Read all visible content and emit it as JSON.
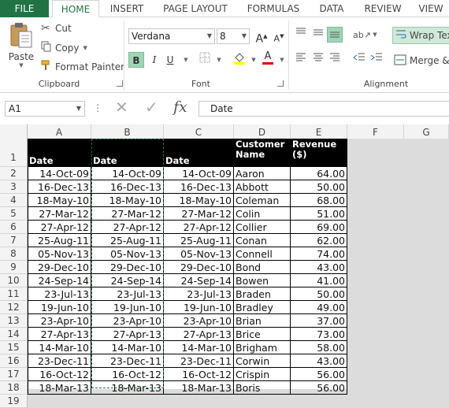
{
  "tabs": [
    "FILE",
    "HOME",
    "INSERT",
    "PAGE LAYOUT",
    "FORMULAS",
    "DATA",
    "REVIEW",
    "VIEW"
  ],
  "clipboard": {
    "paste": "Paste",
    "cut": "Cut",
    "copy": "Copy",
    "format_painter": "Format Painter",
    "label": "Clipboard"
  },
  "font": {
    "name": "Verdana",
    "size": "8",
    "label": "Font",
    "bold": "B",
    "italic": "I",
    "underline": "U",
    "grow": "A",
    "shrink": "A",
    "fill_color": "#ffff00",
    "font_color": "#e00000"
  },
  "alignment": {
    "wrap_text": "Wrap Tex",
    "merge": "Merge &",
    "label": "Alignment"
  },
  "formula_bar": {
    "name_box": "A1",
    "fx": "fx",
    "content": "Date"
  },
  "columns": [
    "A",
    "B",
    "C",
    "D",
    "E",
    "F",
    "G"
  ],
  "rows": [
    "1",
    "2",
    "3",
    "4",
    "5",
    "6",
    "7",
    "8",
    "9",
    "10",
    "11",
    "12",
    "13",
    "14",
    "15",
    "16",
    "17",
    "18",
    "19"
  ],
  "header": {
    "a": "Date",
    "b": "Date",
    "c": "Date",
    "d": "Customer Name",
    "e": "Revenue ($)"
  },
  "data": [
    [
      "14-Oct-09",
      "14-Oct-09",
      "14-Oct-09",
      "Aaron",
      "64.00"
    ],
    [
      "16-Dec-13",
      "16-Dec-13",
      "16-Dec-13",
      "Abbott",
      "50.00"
    ],
    [
      "18-May-10",
      "18-May-10",
      "18-May-10",
      "Coleman",
      "68.00"
    ],
    [
      "27-Mar-12",
      "27-Mar-12",
      "27-Mar-12",
      "Colin",
      "51.00"
    ],
    [
      "27-Apr-12",
      "27-Apr-12",
      "27-Apr-12",
      "Collier",
      "69.00"
    ],
    [
      "25-Aug-11",
      "25-Aug-11",
      "25-Aug-11",
      "Conan",
      "62.00"
    ],
    [
      "05-Nov-13",
      "05-Nov-13",
      "05-Nov-13",
      "Connell",
      "74.00"
    ],
    [
      "29-Dec-10",
      "29-Dec-10",
      "29-Dec-10",
      "Bond",
      "43.00"
    ],
    [
      "24-Sep-14",
      "24-Sep-14",
      "24-Sep-14",
      "Bowen",
      "41.00"
    ],
    [
      "23-Jul-13",
      "23-Jul-13",
      "23-Jul-13",
      "Braden",
      "50.00"
    ],
    [
      "19-Jun-10",
      "19-Jun-10",
      "19-Jun-10",
      "Bradley",
      "49.00"
    ],
    [
      "23-Apr-10",
      "23-Apr-10",
      "23-Apr-10",
      "Brian",
      "37.00"
    ],
    [
      "27-Apr-13",
      "27-Apr-13",
      "27-Apr-13",
      "Brice",
      "73.00"
    ],
    [
      "14-Mar-10",
      "14-Mar-10",
      "14-Mar-10",
      "Brigham",
      "58.00"
    ],
    [
      "23-Dec-11",
      "23-Dec-11",
      "23-Dec-11",
      "Corwin",
      "43.00"
    ],
    [
      "16-Oct-12",
      "16-Oct-12",
      "16-Oct-12",
      "Crispin",
      "56.00"
    ],
    [
      "18-Mar-13",
      "18-Mar-13",
      "18-Mar-13",
      "Boris",
      "56.00"
    ]
  ],
  "colors": {
    "accent": "#217346",
    "header_fill": "#000000",
    "copy_marquee": "#217346"
  }
}
